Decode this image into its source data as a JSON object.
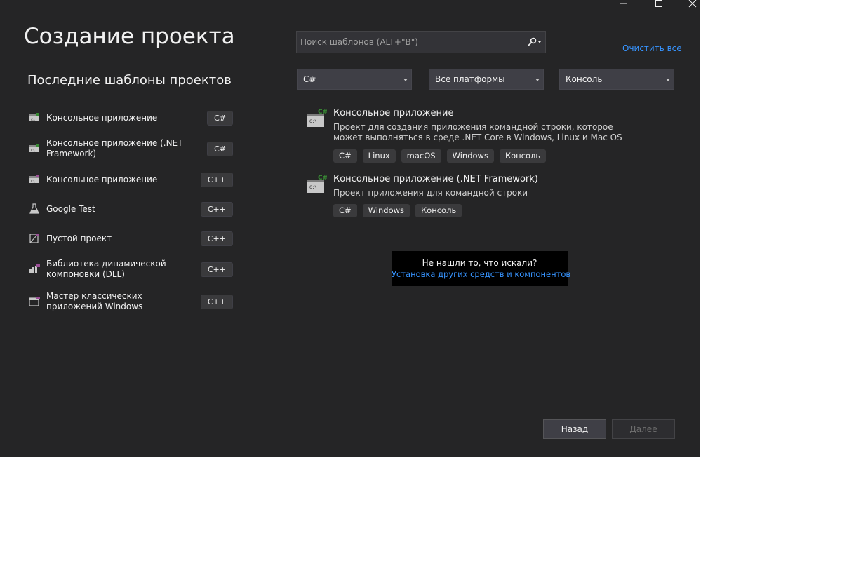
{
  "window": {
    "minimize_glyph": "—",
    "maximize_glyph": "☐",
    "close_glyph": "✕"
  },
  "page_title": "Создание проекта",
  "recent": {
    "title": "Последние шаблоны проектов",
    "items": [
      {
        "label": "Консольное приложение",
        "lang": "C#",
        "icon": "console-app-icon"
      },
      {
        "label": "Консольное приложение (.NET Framework)",
        "lang": "C#",
        "icon": "console-app-icon"
      },
      {
        "label": "Консольное приложение",
        "lang": "C++",
        "icon": "console-app-icon"
      },
      {
        "label": "Google Test",
        "lang": "C++",
        "icon": "flask-icon"
      },
      {
        "label": "Пустой проект",
        "lang": "C++",
        "icon": "empty-project-icon"
      },
      {
        "label": "Библиотека динамической компоновки (DLL)",
        "lang": "C++",
        "icon": "dll-icon"
      },
      {
        "label": "Мастер классических приложений Windows",
        "lang": "C++",
        "icon": "desktop-wizard-icon"
      }
    ]
  },
  "search": {
    "placeholder": "Поиск шаблонов (ALT+\"В\")"
  },
  "clear_all": "Очистить все",
  "filters": {
    "language": "C#",
    "platform": "Все платформы",
    "project_type": "Консоль"
  },
  "templates": [
    {
      "name": "Консольное приложение",
      "description": "Проект для создания приложения командной строки, которое может выполняться в среде .NET Core в Windows, Linux и Mac OS",
      "tags": [
        "C#",
        "Linux",
        "macOS",
        "Windows",
        "Консоль"
      ]
    },
    {
      "name": "Консольное приложение (.NET Framework)",
      "description": "Проект приложения для командной строки",
      "tags": [
        "C#",
        "Windows",
        "Консоль"
      ]
    }
  ],
  "not_found": {
    "question": "Не нашли то, что искали?",
    "link": "Установка других средств и компонентов"
  },
  "buttons": {
    "back": "Назад",
    "next": "Далее"
  },
  "colors": {
    "background": "#252526",
    "accent_link": "#3794ff",
    "csharp_badge": "#388a34"
  }
}
